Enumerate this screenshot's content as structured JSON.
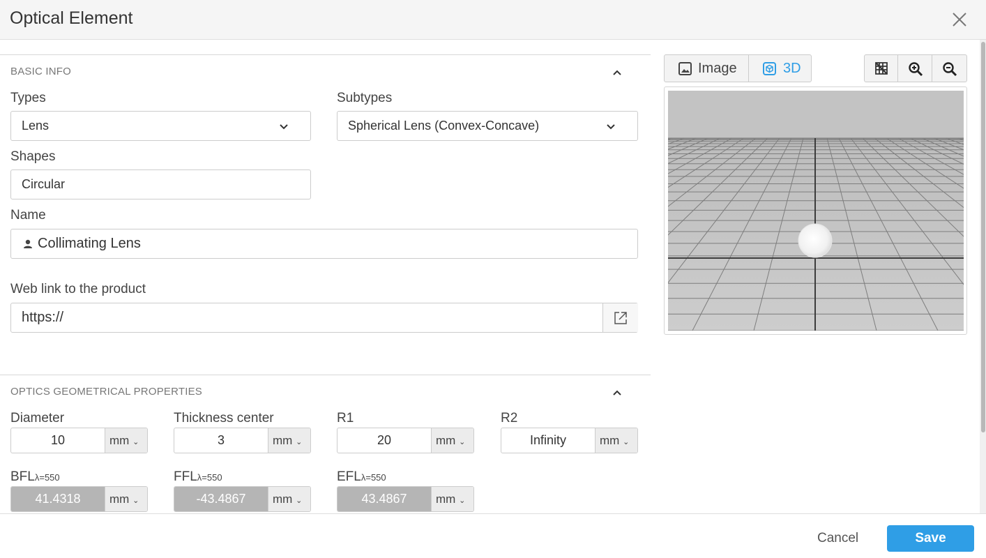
{
  "dialog": {
    "title": "Optical Element"
  },
  "basic_info": {
    "header": "BASIC INFO",
    "types": {
      "label": "Types",
      "value": "Lens"
    },
    "subtypes": {
      "label": "Subtypes",
      "value": "Spherical Lens (Convex-Concave)"
    },
    "shapes": {
      "label": "Shapes",
      "value": "Circular"
    },
    "name": {
      "label": "Name",
      "value": "Collimating Lens"
    },
    "weblink": {
      "label": "Web link to the product",
      "value": "https://"
    }
  },
  "optics": {
    "header": "OPTICS GEOMETRICAL PROPERTIES",
    "diameter": {
      "label": "Diameter",
      "value": "10",
      "unit": "mm"
    },
    "thickness": {
      "label": "Thickness center",
      "value": "3",
      "unit": "mm"
    },
    "r1": {
      "label": "R1",
      "value": "20",
      "unit": "mm"
    },
    "r2": {
      "label": "R2",
      "value": "Infinity",
      "unit": "mm"
    },
    "bfl": {
      "label": "BFL",
      "sub": "λ=550",
      "value": "41.4318",
      "unit": "mm"
    },
    "ffl": {
      "label": "FFL",
      "sub": "λ=550",
      "value": "-43.4867",
      "unit": "mm"
    },
    "efl": {
      "label": "EFL",
      "sub": "λ=550",
      "value": "43.4867",
      "unit": "mm"
    }
  },
  "viewer": {
    "tabs": [
      {
        "label": "Image",
        "active": false
      },
      {
        "label": "3D",
        "active": true
      }
    ],
    "accent": "#2f9ee6"
  },
  "footer": {
    "cancel": "Cancel",
    "save": "Save"
  }
}
